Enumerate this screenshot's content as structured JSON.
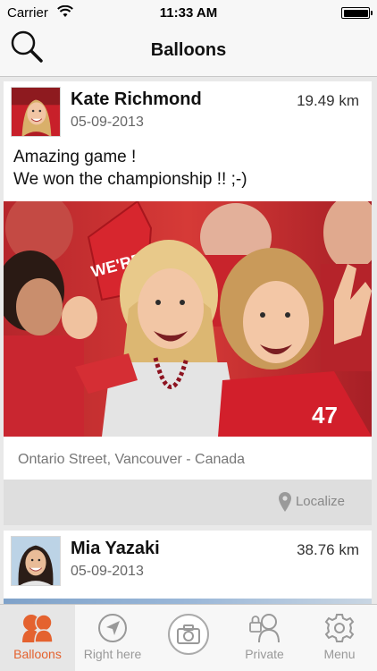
{
  "status_bar": {
    "carrier": "Carrier",
    "time": "11:33 AM"
  },
  "nav": {
    "title": "Balloons"
  },
  "posts": [
    {
      "user_name": "Kate Richmond",
      "date": "05-09-2013",
      "distance": "19.49 km",
      "message_line1": "Amazing game !",
      "message_line2": "We won the championship !! ;-)",
      "photo_jersey_number": "47",
      "location": "Ontario Street, Vancouver - Canada",
      "action_label": "Localize"
    },
    {
      "user_name": "Mia Yazaki",
      "date": "05-09-2013",
      "distance": "38.76 km"
    }
  ],
  "tabs": [
    {
      "label": "Balloons",
      "icon": "balloons-icon",
      "active": true
    },
    {
      "label": "Right here",
      "icon": "location-arrow-icon",
      "active": false
    },
    {
      "label": "",
      "icon": "camera-icon",
      "active": false
    },
    {
      "label": "Private",
      "icon": "private-users-icon",
      "active": false
    },
    {
      "label": "Menu",
      "icon": "gear-icon",
      "active": false
    }
  ],
  "colors": {
    "accent": "#e4622f",
    "inactive": "#999999",
    "bar": "#f7f7f7"
  }
}
